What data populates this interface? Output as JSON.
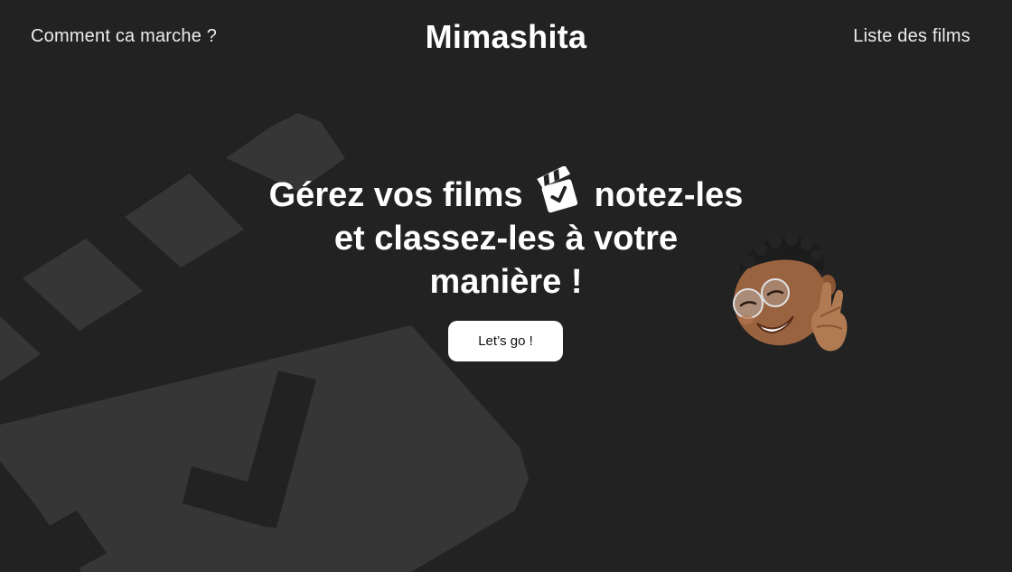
{
  "nav": {
    "left_link": "Comment ca marche ?",
    "brand": "Mimashita",
    "right_link": "Liste des films"
  },
  "hero": {
    "line1_start": "Gérez vos films",
    "line1_end": "notez-les",
    "line2": "et classez-les à votre",
    "line3": "manière !",
    "inline_icon": "clapperboard-check-icon"
  },
  "cta": {
    "label": "Let’s go !"
  },
  "decor": {
    "background_icon": "clapperboard-check-icon",
    "avatar": "memoji-fingers-crossed"
  },
  "colors": {
    "background": "#222222",
    "decor": "#363636",
    "text": "#ffffff",
    "button_bg": "#ffffff",
    "button_text": "#111111"
  }
}
